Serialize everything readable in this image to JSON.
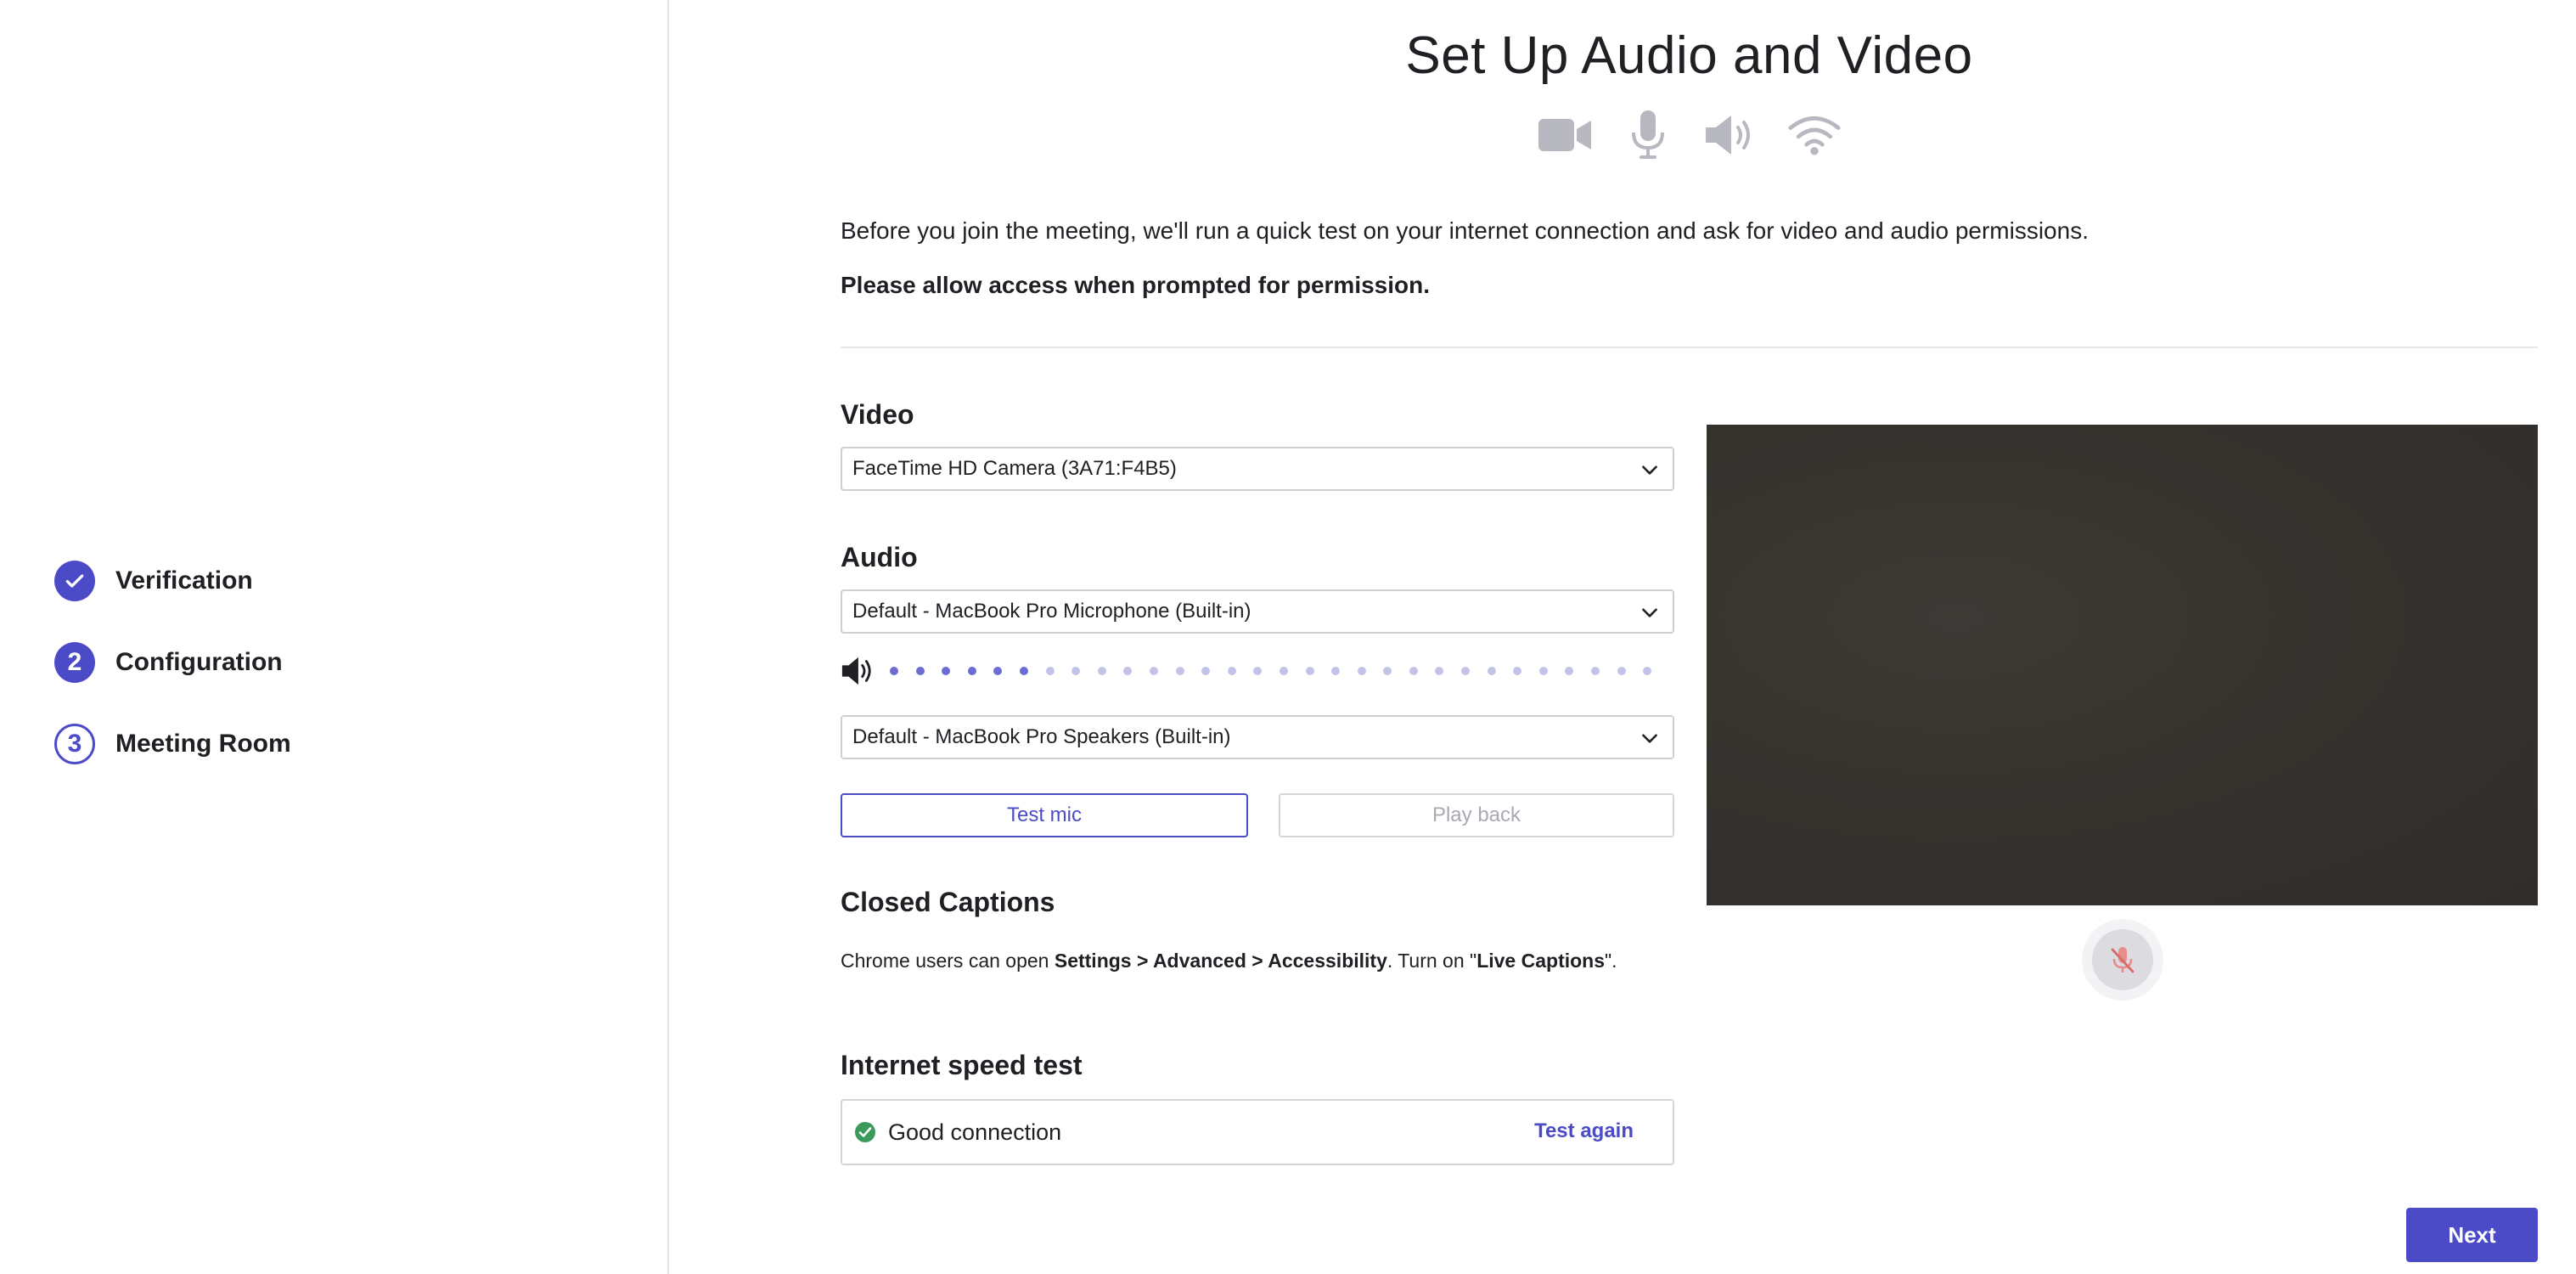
{
  "steps": [
    {
      "label": "Verification",
      "badge": "",
      "state": "done"
    },
    {
      "label": "Configuration",
      "badge": "2",
      "state": "current"
    },
    {
      "label": "Meeting Room",
      "badge": "3",
      "state": "todo"
    }
  ],
  "header": {
    "title": "Set Up Audio and Video",
    "icons": [
      "video-camera-icon",
      "microphone-icon",
      "speaker-icon",
      "wifi-icon"
    ]
  },
  "intro": {
    "text": "Before you join the meeting, we'll run a quick test on your internet connection and ask for video and audio permissions.",
    "bold": "Please allow access when prompted for permission."
  },
  "video": {
    "title": "Video",
    "selected": "FaceTime HD Camera (3A71:F4B5)"
  },
  "audio": {
    "title": "Audio",
    "microphone": "Default - MacBook Pro Microphone (Built-in)",
    "speaker": "Default - MacBook Pro Speakers (Built-in)",
    "level_dots_total": 30,
    "level_dots_active": 6,
    "test_mic_label": "Test mic",
    "play_back_label": "Play back"
  },
  "captions": {
    "title": "Closed Captions",
    "text_before": "Chrome users can open ",
    "path": "Settings > Advanced > Accessibility",
    "text_middle": ". Turn on \"",
    "feature": "Live Captions",
    "text_after": "\"."
  },
  "speed": {
    "title": "Internet speed test",
    "status": "Good connection",
    "retry_label": "Test again"
  },
  "next_label": "Next",
  "colors": {
    "accent": "#4b4bc8",
    "success": "#3a9a5b",
    "icon_gray": "#b8b8c0"
  }
}
